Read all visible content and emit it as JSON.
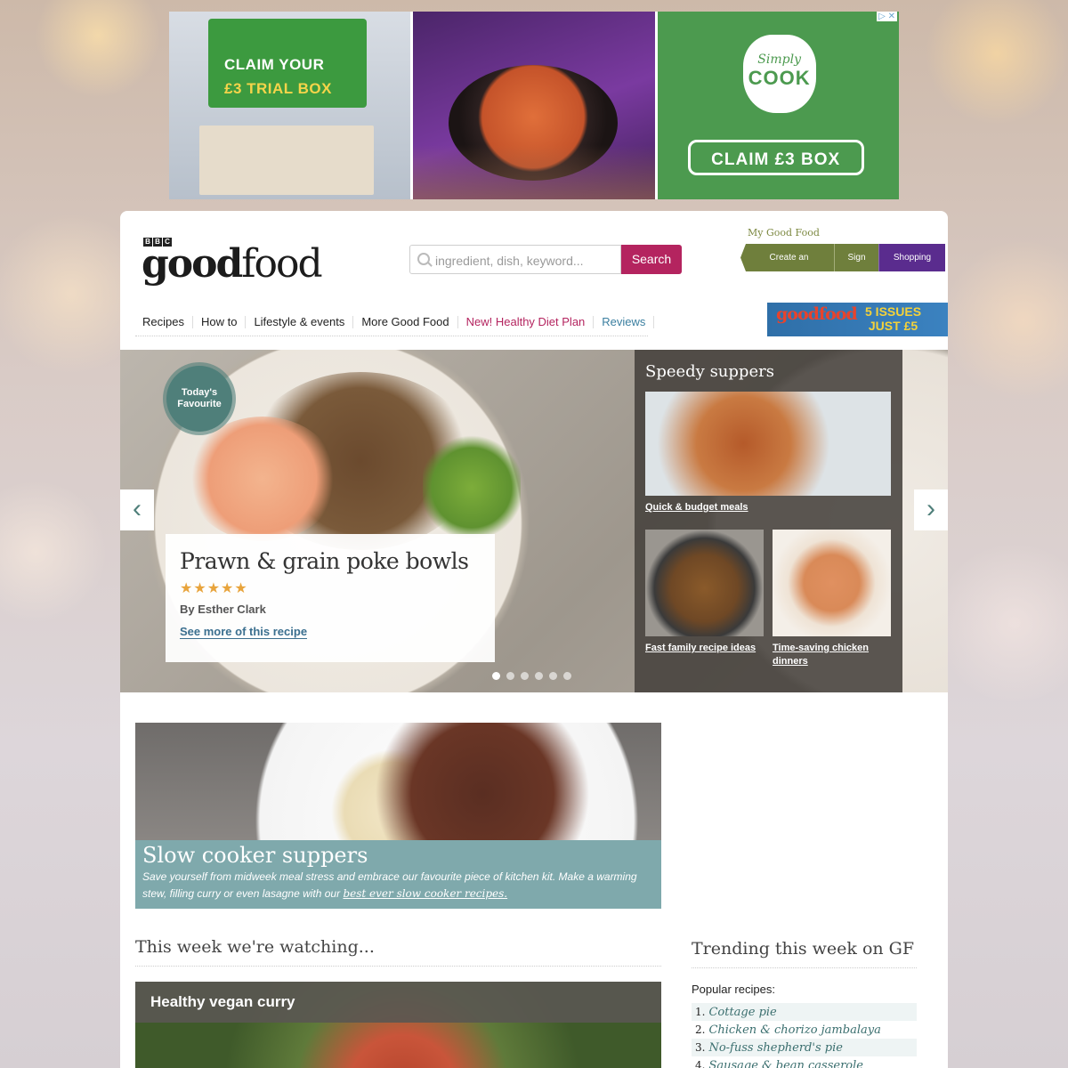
{
  "ad": {
    "trial_line1": "CLAIM YOUR",
    "trial_line2": "£3 TRIAL BOX",
    "logo_simply": "Simply",
    "logo_cook": "COOK",
    "claim_button": "CLAIM £3 BOX",
    "adchoices": "▷ ✕",
    "brand_green": "#4c9a4f"
  },
  "header": {
    "bbc": [
      "B",
      "B",
      "C"
    ],
    "logo_bold": "good",
    "logo_light": "food",
    "search_placeholder": "ingredient, dish, keyword...",
    "search_button": "Search",
    "my_good_food": "My Good Food",
    "create_account": "Create an account",
    "sign_in": "Sign in",
    "shopping_list": "Shopping List"
  },
  "nav": {
    "items": [
      "Recipes",
      "How to",
      "Lifestyle & events",
      "More Good Food",
      "New! Healthy Diet Plan",
      "Reviews"
    ]
  },
  "magazine_ad": {
    "title": "goodfood",
    "offer_line1": "5 ISSUES",
    "offer_line2": "JUST £5"
  },
  "hero": {
    "badge": "Today's Favourite",
    "recipe_title": "Prawn & grain poke bowls",
    "rating": 5,
    "stars": "★★★★★",
    "author": "By Esther Clark",
    "see_more": "See more of this recipe",
    "prev_icon": "chevron-left-icon",
    "next_icon": "chevron-right-icon",
    "arrow_left": "‹",
    "arrow_right": "›",
    "slide_count": 6,
    "active_slide": 1
  },
  "speedy": {
    "title": "Speedy suppers",
    "links": [
      "Quick & budget meals",
      "Fast family recipe ideas",
      "Time-saving chicken dinners"
    ]
  },
  "slow_cooker": {
    "title": "Slow cooker suppers",
    "text": "Save yourself from midweek meal stress and embrace our favourite piece of kitchen kit. Make a warming stew, filling curry or even lasagne with our ",
    "link": "best ever slow cooker recipes."
  },
  "watching": {
    "heading": "This week we're watching...",
    "video_title": "Healthy vegan curry"
  },
  "trending": {
    "heading": "Trending this week on GF",
    "subheading": "Popular recipes:",
    "items": [
      {
        "n": "1.",
        "name": "Cottage pie"
      },
      {
        "n": "2.",
        "name": "Chicken & chorizo jambalaya"
      },
      {
        "n": "3.",
        "name": "No-fuss shepherd's pie"
      },
      {
        "n": "4.",
        "name": "Sausage & bean casserole"
      }
    ]
  }
}
